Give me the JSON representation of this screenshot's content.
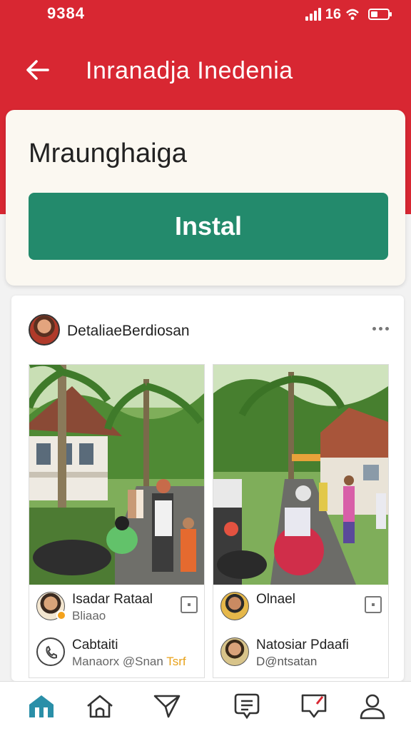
{
  "status_bar": {
    "time": "9384",
    "network": "16"
  },
  "app_bar": {
    "title": "Inranadja Inedenia"
  },
  "install_card": {
    "app_name": "Mraunghaiga",
    "install_label": "Instal"
  },
  "post": {
    "author": "DetaliaeBerdiosan",
    "cards": [
      {
        "meta_1": {
          "name": "Isadar Rataal",
          "sub": "Bliaao"
        },
        "meta_2": {
          "name": "Cabtaiti",
          "sub_prefix": "Manaorx @Snan",
          "sub_highlight": "Tsrf"
        }
      },
      {
        "meta_1": {
          "name": "Olnael",
          "sub": ""
        },
        "meta_2": {
          "name": "Natosiar Pdaafi",
          "sub": "D@ntsatan"
        }
      }
    ]
  },
  "colors": {
    "brand": "#d82732",
    "install": "#238a6c",
    "nav_active": "#2a8fa8"
  },
  "bottom_nav": [
    "home-active-icon",
    "home-outline-icon",
    "send-icon",
    "chat-icon",
    "inbox-icon",
    "profile-icon"
  ]
}
